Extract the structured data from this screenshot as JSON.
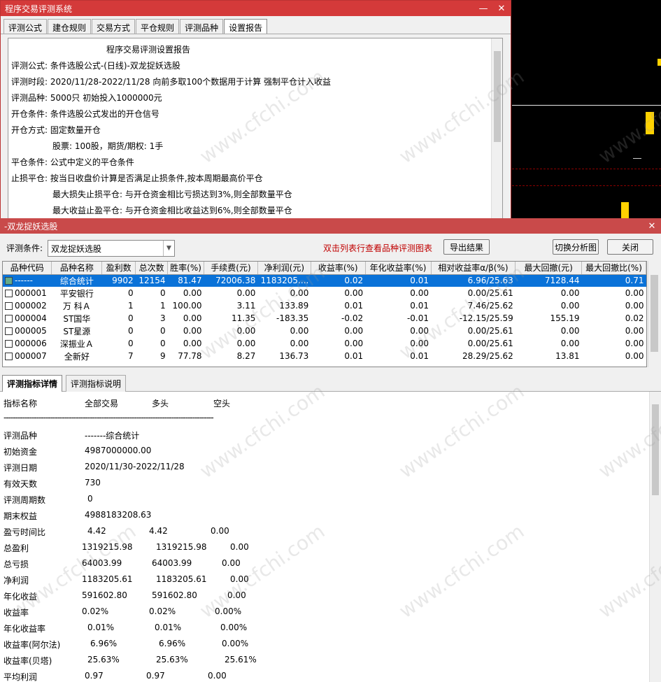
{
  "window1": {
    "title": "程序交易评测系统",
    "tabs": [
      "评测公式",
      "建仓规则",
      "交易方式",
      "平仓规则",
      "评测品种",
      "设置报告"
    ],
    "report_title": "程序交易评测设置报告",
    "lines": [
      "评测公式:  条件选股公式-(日线)-双龙捉妖选股",
      "评测时段:  2020/11/28-2022/11/28 向前多取100个数据用于计算 强制平仓计入收益",
      "评测品种:  5000只 初始投入1000000元",
      "开仓条件:  条件选股公式发出的开仓信号",
      "开仓方式:  固定数量开仓",
      "股票: 100股，期货/期权: 1手",
      "平仓条件:  公式中定义的平仓条件",
      "止损平仓:  按当日收盘价计算是否满足止损条件,按本周期最高价平仓",
      "最大损失止损平仓:  与开仓资金相比亏损达到3%,则全部数量平仓",
      "最大收益止盈平仓:  与开仓资金相比收益达到6%,则全部数量平仓"
    ]
  },
  "window2": {
    "title": "-双龙捉妖选股",
    "condition_label": "评测条件:",
    "condition_value": "双龙捉妖选股",
    "hint": "双击列表行查看品种评测图表",
    "export_button": "导出结果",
    "switch_button": "切换分析图",
    "close_button": "关闭",
    "columns": [
      "品种代码",
      "品种名称",
      "盈利数",
      "总次数",
      "胜率(%)",
      "手续费(元)",
      "净利润(元)",
      "收益率(%)",
      "年化收益率(%)",
      "相对收益率α/β(%)",
      "最大回撤(元)",
      "最大回撤比(%)"
    ],
    "rows": [
      [
        "------",
        "综合统计",
        "9902",
        "12154",
        "81.47",
        "72006.38",
        "1183205....",
        "0.02",
        "0.01",
        "6.96/25.63",
        "7128.44",
        "0.71"
      ],
      [
        "000001",
        "平安银行",
        "0",
        "0",
        "0.00",
        "0.00",
        "0.00",
        "0.00",
        "0.00",
        "0.00/25.61",
        "0.00",
        "0.00"
      ],
      [
        "000002",
        "万 科Ａ",
        "1",
        "1",
        "100.00",
        "3.11",
        "133.89",
        "0.01",
        "0.01",
        "7.46/25.62",
        "0.00",
        "0.00"
      ],
      [
        "000004",
        "ST国华",
        "0",
        "3",
        "0.00",
        "11.35",
        "-183.35",
        "-0.02",
        "-0.01",
        "-12.15/25.59",
        "155.19",
        "0.02"
      ],
      [
        "000005",
        "ST星源",
        "0",
        "0",
        "0.00",
        "0.00",
        "0.00",
        "0.00",
        "0.00",
        "0.00/25.61",
        "0.00",
        "0.00"
      ],
      [
        "000006",
        "深振业Ａ",
        "0",
        "0",
        "0.00",
        "0.00",
        "0.00",
        "0.00",
        "0.00",
        "0.00/25.61",
        "0.00",
        "0.00"
      ],
      [
        "000007",
        "全新好",
        "7",
        "9",
        "77.78",
        "8.27",
        "136.73",
        "0.01",
        "0.01",
        "28.29/25.62",
        "13.81",
        "0.00"
      ]
    ],
    "detail_tabs": [
      "评测指标详情",
      "评测指标说明"
    ],
    "detail_header": [
      "指标名称",
      "全部交易",
      "多头",
      "空头"
    ],
    "separator": "------------------------------------------------------------------------------------------",
    "detail_rows": [
      [
        "评测品种",
        "-------综合统计",
        "",
        ""
      ],
      [
        "初始资金",
        "4987000000.00",
        "",
        ""
      ],
      [
        "评测日期",
        "2020/11/30-2022/11/28",
        "",
        ""
      ],
      [
        "有效天数",
        "730",
        "",
        ""
      ],
      [
        "评测周期数",
        "0",
        "",
        ""
      ],
      [
        "期末权益",
        "4988183208.63",
        "",
        ""
      ],
      [
        "盈亏时间比",
        "4.42",
        "4.42",
        "0.00"
      ],
      [
        "总盈利",
        "1319215.98",
        "1319215.98",
        "0.00"
      ],
      [
        "总亏损",
        "64003.99",
        "64003.99",
        "0.00"
      ],
      [
        "净利润",
        "1183205.61",
        "1183205.61",
        "0.00"
      ],
      [
        "年化收益",
        "591602.80",
        "591602.80",
        "0.00"
      ],
      [
        "收益率",
        "0.02%",
        "0.02%",
        "0.00%"
      ],
      [
        "年化收益率",
        "0.01%",
        "0.01%",
        "0.00%"
      ],
      [
        "收益率(阿尔法)",
        "6.96%",
        "6.96%",
        "0.00%"
      ],
      [
        "收益率(贝塔)",
        "25.63%",
        "25.63%",
        "25.61%"
      ],
      [
        "平均利润",
        "0.97",
        "0.97",
        "0.00"
      ]
    ]
  },
  "watermark": "www.cfchi.com",
  "colors": {
    "titlebar": "#d43a3a",
    "selection": "#0a72d8",
    "hint": "#c00000",
    "candle": "#ffd200"
  }
}
